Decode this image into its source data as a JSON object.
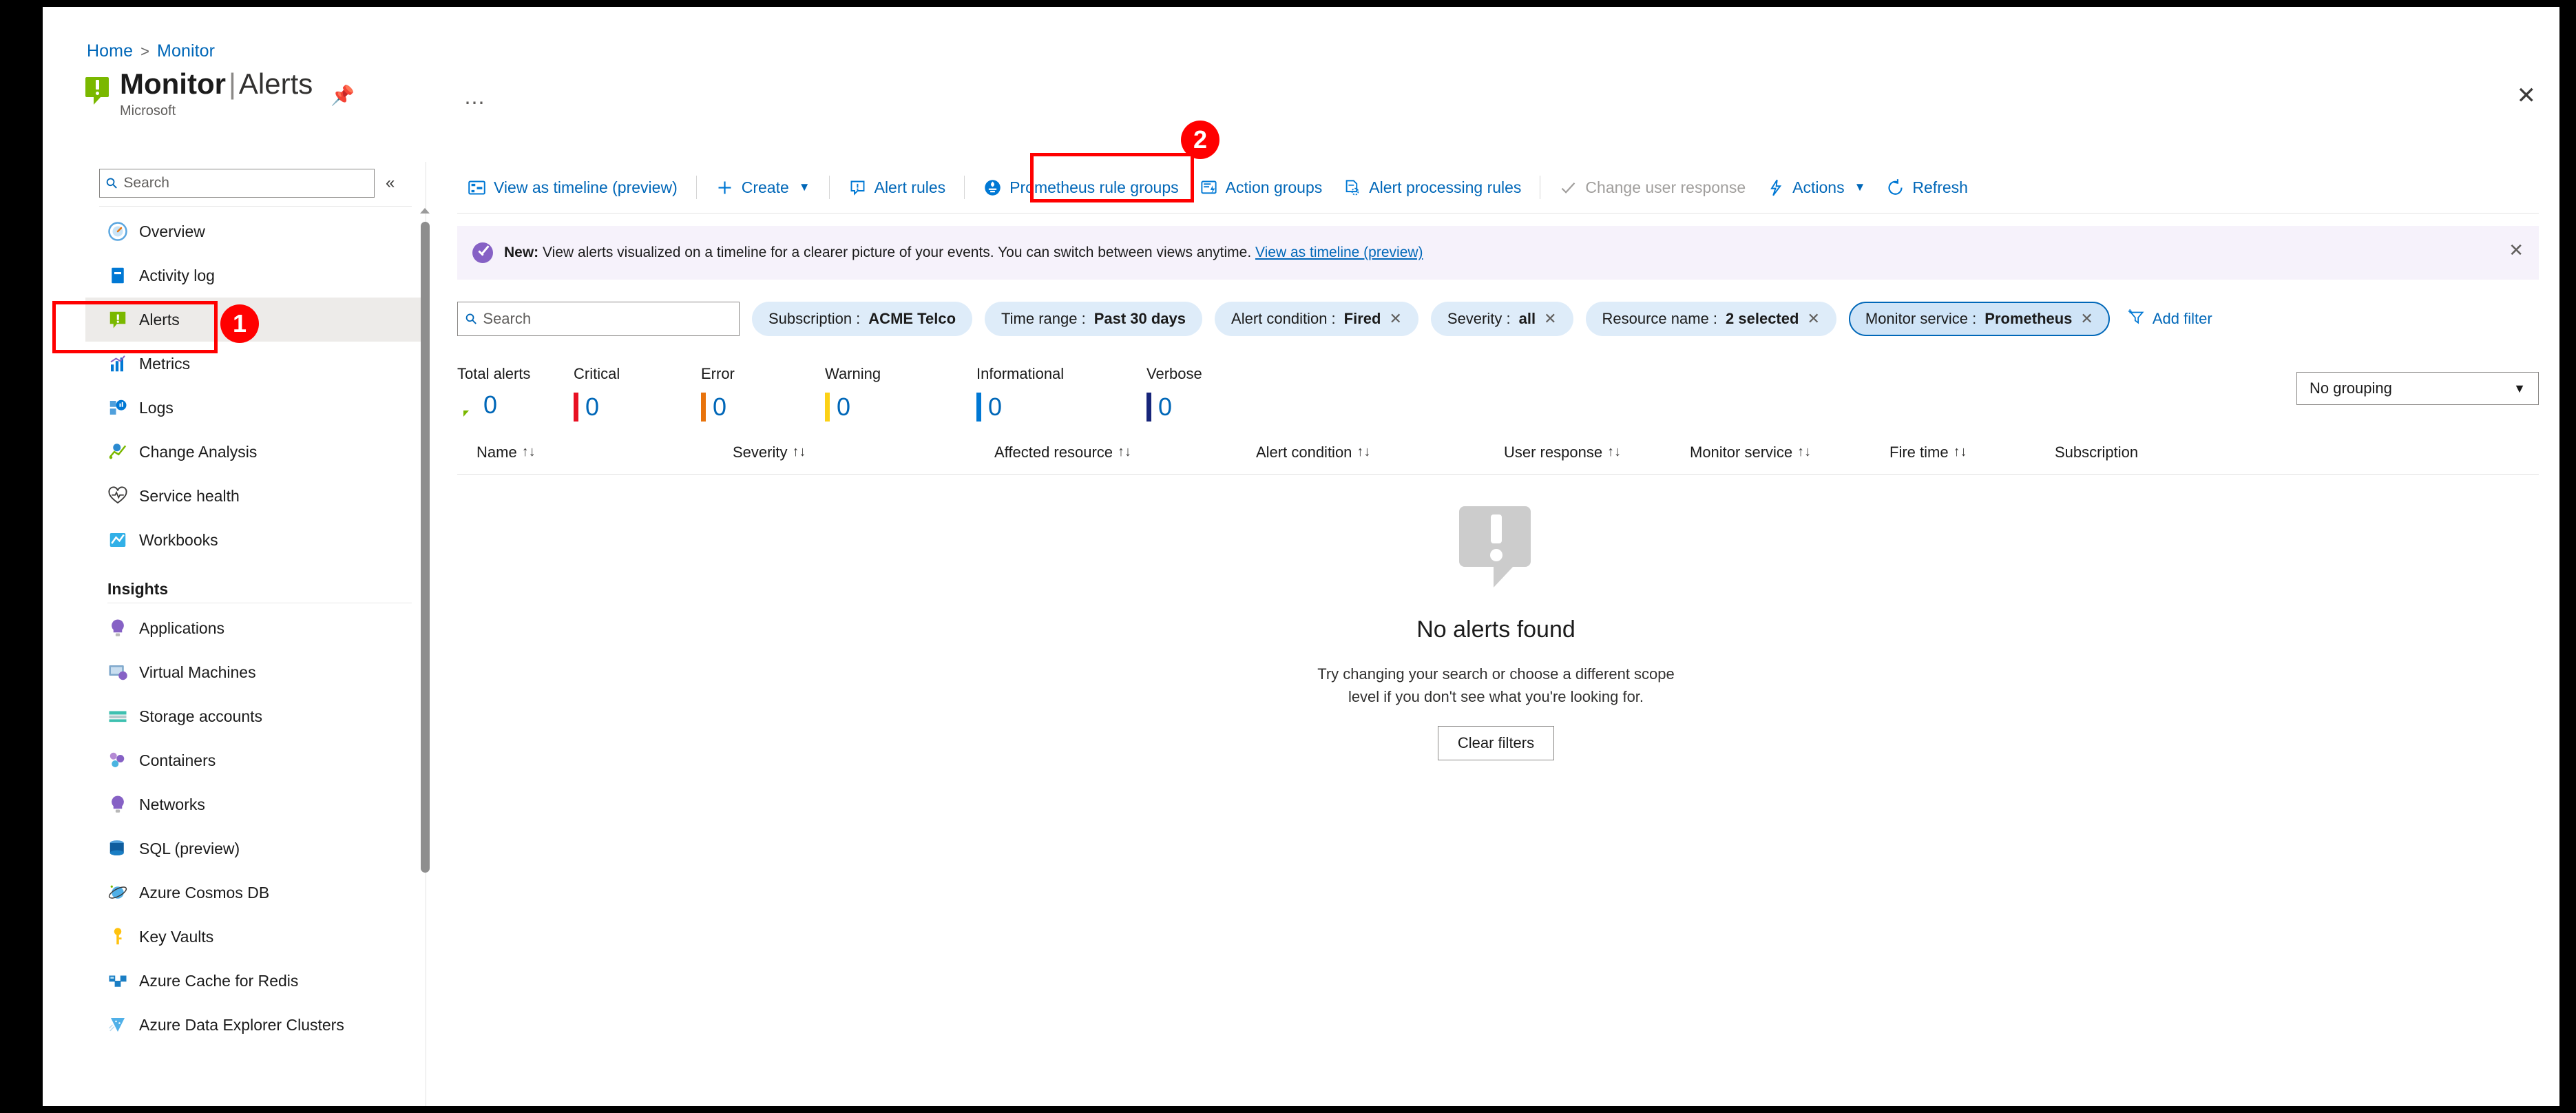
{
  "breadcrumb": {
    "home": "Home",
    "separator": ">",
    "current": "Monitor"
  },
  "header": {
    "title_main": "Monitor",
    "title_pipe": "|",
    "title_sub_page": "Alerts",
    "publisher": "Microsoft",
    "pin_icon": "pin-icon",
    "more_icon": "ellipsis-icon",
    "close_icon": "close-icon"
  },
  "sidebar": {
    "search_placeholder": "Search",
    "collapse_icon": "collapse-chevrons-icon",
    "items": [
      {
        "label": "Overview",
        "icon": "gauge-icon",
        "selected": false
      },
      {
        "label": "Activity log",
        "icon": "book-icon",
        "selected": false
      },
      {
        "label": "Alerts",
        "icon": "alert-bubble-icon",
        "selected": true
      },
      {
        "label": "Metrics",
        "icon": "bar-chart-icon",
        "selected": false
      },
      {
        "label": "Logs",
        "icon": "logs-icon",
        "selected": false
      },
      {
        "label": "Change Analysis",
        "icon": "change-analysis-icon",
        "selected": false
      },
      {
        "label": "Service health",
        "icon": "heartbeat-icon",
        "selected": false
      },
      {
        "label": "Workbooks",
        "icon": "workbook-icon",
        "selected": false
      }
    ],
    "insights_section": "Insights",
    "insights_items": [
      {
        "label": "Applications",
        "icon": "lightbulb-purple-icon"
      },
      {
        "label": "Virtual Machines",
        "icon": "virtual-machine-icon"
      },
      {
        "label": "Storage accounts",
        "icon": "storage-account-icon"
      },
      {
        "label": "Containers",
        "icon": "containers-icon"
      },
      {
        "label": "Networks",
        "icon": "network-lightbulb-icon"
      },
      {
        "label": "SQL (preview)",
        "icon": "sql-database-icon"
      },
      {
        "label": "Azure Cosmos DB",
        "icon": "cosmos-db-icon"
      },
      {
        "label": "Key Vaults",
        "icon": "key-icon"
      },
      {
        "label": "Azure Cache for Redis",
        "icon": "redis-cache-icon"
      },
      {
        "label": "Azure Data Explorer Clusters",
        "icon": "data-explorer-icon"
      }
    ]
  },
  "toolbar": {
    "view_timeline": "View as timeline (preview)",
    "create": "Create",
    "alert_rules": "Alert rules",
    "prometheus_rule_groups": "Prometheus rule groups",
    "action_groups": "Action groups",
    "alert_processing_rules": "Alert processing rules",
    "change_user_response": "Change user response",
    "actions": "Actions",
    "refresh": "Refresh"
  },
  "banner": {
    "bold_prefix": "New:",
    "text": " View alerts visualized on a timeline for a clearer picture of your events. You can switch between views anytime. ",
    "link": "View as timeline (preview)",
    "close_icon": "banner-close-icon"
  },
  "filters": {
    "search_placeholder": "Search",
    "chips": [
      {
        "label": "Subscription :",
        "value": "ACME Telco",
        "removable": false,
        "active": false
      },
      {
        "label": "Time range :",
        "value": "Past 30 days",
        "removable": false,
        "active": false
      },
      {
        "label": "Alert condition :",
        "value": "Fired",
        "removable": true,
        "active": false
      },
      {
        "label": "Severity :",
        "value": "all",
        "removable": true,
        "active": false
      },
      {
        "label": "Resource name :",
        "value": "2 selected",
        "removable": true,
        "active": false
      },
      {
        "label": "Monitor service :",
        "value": "Prometheus",
        "removable": true,
        "active": true
      }
    ],
    "add_filter": "Add filter"
  },
  "summary": {
    "items": [
      {
        "label": "Total alerts",
        "value": "0",
        "color": "#7ab800",
        "kind": "icon"
      },
      {
        "label": "Critical",
        "value": "0",
        "color": "#e81123",
        "kind": "bar"
      },
      {
        "label": "Error",
        "value": "0",
        "color": "#e8730c",
        "kind": "bar"
      },
      {
        "label": "Warning",
        "value": "0",
        "color": "#fcd116",
        "kind": "bar"
      },
      {
        "label": "Informational",
        "value": "0",
        "color": "#0078d4",
        "kind": "bar"
      },
      {
        "label": "Verbose",
        "value": "0",
        "color": "#17257a",
        "kind": "bar"
      }
    ]
  },
  "grouping": {
    "value": "No grouping",
    "chevron_icon": "chevron-down-icon"
  },
  "table": {
    "columns": [
      {
        "label": "Name",
        "sortable": true
      },
      {
        "label": "Severity",
        "sortable": true
      },
      {
        "label": "Affected resource",
        "sortable": true
      },
      {
        "label": "Alert condition",
        "sortable": true
      },
      {
        "label": "User response",
        "sortable": true
      },
      {
        "label": "Monitor service",
        "sortable": true
      },
      {
        "label": "Fire time",
        "sortable": true
      },
      {
        "label": "Subscription",
        "sortable": false
      }
    ],
    "rows": []
  },
  "empty_state": {
    "title": "No alerts found",
    "description": "Try changing your search or choose a different scope level if you don't see what you're looking for.",
    "button": "Clear filters",
    "icon": "alert-bubble-grey-icon"
  },
  "annotations": [
    {
      "number": "1",
      "target": "sidebar-item-alerts"
    },
    {
      "number": "2",
      "target": "toolbar-prometheus-rule-groups"
    }
  ],
  "colors": {
    "accent": "#0067b8",
    "annotation": "#ff0000",
    "chip_bg": "#deecf9",
    "banner_bg": "#f6f2fb",
    "selected_nav": "#edebe9"
  }
}
